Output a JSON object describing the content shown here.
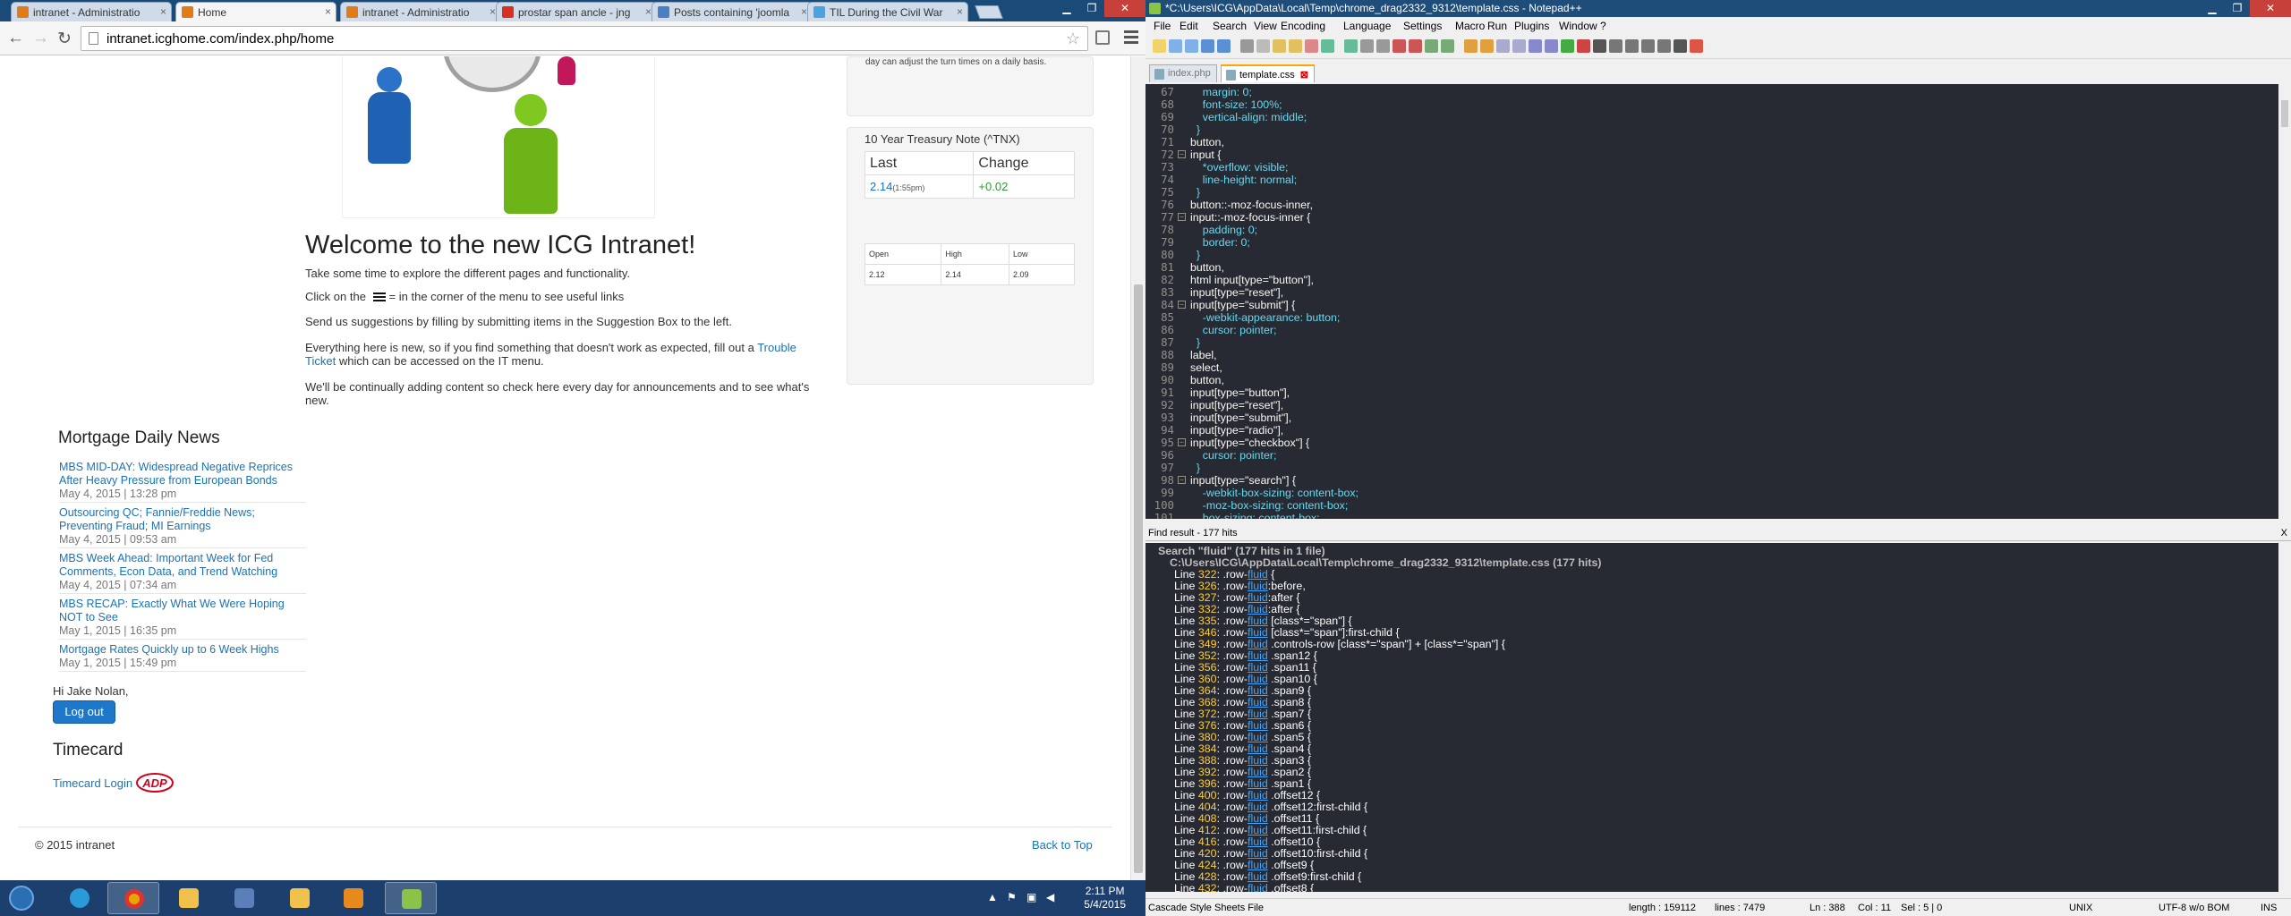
{
  "chrome": {
    "tabs": [
      {
        "title": "intranet - Administratio",
        "active": false
      },
      {
        "title": "Home",
        "active": true
      },
      {
        "title": "intranet - Administratio",
        "active": false
      },
      {
        "title": "prostar span ancle - jng",
        "active": false
      },
      {
        "title": "Posts containing 'joomla",
        "active": false
      },
      {
        "title": "TIL During the Civil War",
        "active": false
      }
    ],
    "url": "intranet.icghome.com/index.php/home"
  },
  "page": {
    "top_panel_text": "day can adjust the turn times on a daily basis.",
    "welcome_title": "Welcome to the new ICG Intranet!",
    "p1": "Take some time to explore the different pages and functionality.",
    "p2_before": "Click on  the",
    "p2_after": "= in the corner of the menu to see useful links",
    "p3": "Send us suggestions by filling by submitting items in the Suggestion Box to the left.",
    "p4_before": "Everything here is new, so if you find something that doesn't work as expected, fill out a",
    "p4_link": "Trouble Ticket",
    "p4_after": "which can be accessed on the IT menu.",
    "p5": "We'll be continually adding content so check here every day for announcements and to see what's new.",
    "mortgage_title": "Mortgage Daily News",
    "news": [
      {
        "title": "MBS MID-DAY: Widespread Negative Reprices After Heavy Pressure from European Bonds",
        "date": "May 4, 2015 | 13:28 pm"
      },
      {
        "title": "Outsourcing QC; Fannie/Freddie News; Preventing Fraud; MI Earnings",
        "date": "May 4, 2015 | 09:53 am"
      },
      {
        "title": "MBS Week Ahead: Important Week for Fed Comments, Econ Data, and Trend Watching",
        "date": "May 4, 2015 | 07:34 am"
      },
      {
        "title": "MBS RECAP: Exactly What We Were Hoping NOT to See",
        "date": "May 1, 2015 | 16:35 pm"
      },
      {
        "title": "Mortgage Rates Quickly up to 6 Week Highs",
        "date": "May 1, 2015 | 15:49 pm"
      }
    ],
    "greeting": "Hi Jake Nolan,",
    "logout_label": "Log out",
    "timecard_title": "Timecard",
    "timecard_link": "Timecard Login",
    "adp_text": "ADP",
    "copyright": "© 2015 intranet",
    "back_to_top": "Back to Top",
    "treasury": {
      "title": "10 Year Treasury Note (^TNX)",
      "col_last": "Last",
      "col_change": "Change",
      "last": "2.14",
      "last_time": "(1:55pm)",
      "change": "+0.02",
      "open_label": "Open",
      "high_label": "High",
      "low_label": "Low",
      "open": "2.12",
      "high": "2.14",
      "low": "2.09"
    }
  },
  "npp": {
    "title": "*C:\\Users\\ICG\\AppData\\Local\\Temp\\chrome_drag2332_9312\\template.css - Notepad++",
    "menu": [
      "File",
      "Edit",
      "Search",
      "View",
      "Encoding",
      "Language",
      "Settings",
      "Macro",
      "Run",
      "Plugins",
      "Window",
      "?"
    ],
    "tabs": [
      {
        "name": "index.php",
        "active": false
      },
      {
        "name": "template.css",
        "active": true
      }
    ],
    "code_lines": [
      {
        "n": "67",
        "t": "    margin: 0;"
      },
      {
        "n": "68",
        "t": "    font-size: 100%;"
      },
      {
        "n": "69",
        "t": "    vertical-align: middle;"
      },
      {
        "n": "70",
        "t": "  }"
      },
      {
        "n": "71",
        "t": "button,"
      },
      {
        "n": "72",
        "t": "input {",
        "f": true
      },
      {
        "n": "73",
        "t": "    *overflow: visible;"
      },
      {
        "n": "74",
        "t": "    line-height: normal;"
      },
      {
        "n": "75",
        "t": "  }"
      },
      {
        "n": "76",
        "t": "button::-moz-focus-inner,"
      },
      {
        "n": "77",
        "t": "input::-moz-focus-inner {",
        "f": true
      },
      {
        "n": "78",
        "t": "    padding: 0;"
      },
      {
        "n": "79",
        "t": "    border: 0;"
      },
      {
        "n": "80",
        "t": "  }"
      },
      {
        "n": "81",
        "t": "button,"
      },
      {
        "n": "82",
        "t": "html input[type=\"button\"],"
      },
      {
        "n": "83",
        "t": "input[type=\"reset\"],"
      },
      {
        "n": "84",
        "t": "input[type=\"submit\"] {",
        "f": true
      },
      {
        "n": "85",
        "t": "    -webkit-appearance: button;"
      },
      {
        "n": "86",
        "t": "    cursor: pointer;"
      },
      {
        "n": "87",
        "t": "  }"
      },
      {
        "n": "88",
        "t": "label,"
      },
      {
        "n": "89",
        "t": "select,"
      },
      {
        "n": "90",
        "t": "button,"
      },
      {
        "n": "91",
        "t": "input[type=\"button\"],"
      },
      {
        "n": "92",
        "t": "input[type=\"reset\"],"
      },
      {
        "n": "93",
        "t": "input[type=\"submit\"],"
      },
      {
        "n": "94",
        "t": "input[type=\"radio\"],"
      },
      {
        "n": "95",
        "t": "input[type=\"checkbox\"] {",
        "f": true
      },
      {
        "n": "96",
        "t": "    cursor: pointer;"
      },
      {
        "n": "97",
        "t": "  }"
      },
      {
        "n": "98",
        "t": "input[type=\"search\"] {",
        "f": true
      },
      {
        "n": "99",
        "t": "    -webkit-box-sizing: content-box;"
      },
      {
        "n": "100",
        "t": "    -moz-box-sizing: content-box;"
      },
      {
        "n": "101",
        "t": "    box-sizing: content-box;"
      }
    ],
    "find_label": "Find result - 177 hits",
    "find_close": "X",
    "search_header": "Search \"fluid\" (177 hits in 1 file)",
    "file_header": "C:\\Users\\ICG\\AppData\\Local\\Temp\\chrome_drag2332_9312\\template.css (177 hits)",
    "results": [
      {
        "n": "322",
        "pre": ".row-",
        "post": " {"
      },
      {
        "n": "326",
        "pre": ".row-",
        "post": ":before,"
      },
      {
        "n": "327",
        "pre": ".row-",
        "post": ":after {"
      },
      {
        "n": "332",
        "pre": ".row-",
        "post": ":after {"
      },
      {
        "n": "335",
        "pre": ".row-",
        "post": " [class*=\"span\"] {"
      },
      {
        "n": "346",
        "pre": ".row-",
        "post": " [class*=\"span\"]:first-child {"
      },
      {
        "n": "349",
        "pre": ".row-",
        "post": " .controls-row [class*=\"span\"] + [class*=\"span\"] {"
      },
      {
        "n": "352",
        "pre": ".row-",
        "post": " .span12 {"
      },
      {
        "n": "356",
        "pre": ".row-",
        "post": " .span11 {"
      },
      {
        "n": "360",
        "pre": ".row-",
        "post": " .span10 {"
      },
      {
        "n": "364",
        "pre": ".row-",
        "post": " .span9 {"
      },
      {
        "n": "368",
        "pre": ".row-",
        "post": " .span8 {"
      },
      {
        "n": "372",
        "pre": ".row-",
        "post": " .span7 {"
      },
      {
        "n": "376",
        "pre": ".row-",
        "post": " .span6 {"
      },
      {
        "n": "380",
        "pre": ".row-",
        "post": " .span5 {"
      },
      {
        "n": "384",
        "pre": ".row-",
        "post": " .span4 {"
      },
      {
        "n": "388",
        "pre": ".row-",
        "post": " .span3 {"
      },
      {
        "n": "392",
        "pre": ".row-",
        "post": " .span2 {"
      },
      {
        "n": "396",
        "pre": ".row-",
        "post": " .span1 {"
      },
      {
        "n": "400",
        "pre": ".row-",
        "post": " .offset12 {"
      },
      {
        "n": "404",
        "pre": ".row-",
        "post": " .offset12:first-child {"
      },
      {
        "n": "408",
        "pre": ".row-",
        "post": " .offset11 {"
      },
      {
        "n": "412",
        "pre": ".row-",
        "post": " .offset11:first-child {"
      },
      {
        "n": "416",
        "pre": ".row-",
        "post": " .offset10 {"
      },
      {
        "n": "420",
        "pre": ".row-",
        "post": " .offset10:first-child {"
      },
      {
        "n": "424",
        "pre": ".row-",
        "post": " .offset9 {"
      },
      {
        "n": "428",
        "pre": ".row-",
        "post": " .offset9:first-child {"
      },
      {
        "n": "432",
        "pre": ".row-",
        "post": " .offset8 {"
      }
    ],
    "hit_word": "fluid",
    "line_label": "Line",
    "status": {
      "filetype": "Cascade Style Sheets File",
      "length": "length : 159112",
      "lines": "lines : 7479",
      "ln": "Ln : 388",
      "col": "Col : 11",
      "sel": "Sel : 5 | 0",
      "eol": "UNIX",
      "enc": "UTF-8 w/o BOM",
      "ins": "INS"
    }
  },
  "taskbar": {
    "time": "2:11 PM",
    "date": "5/4/2015"
  }
}
